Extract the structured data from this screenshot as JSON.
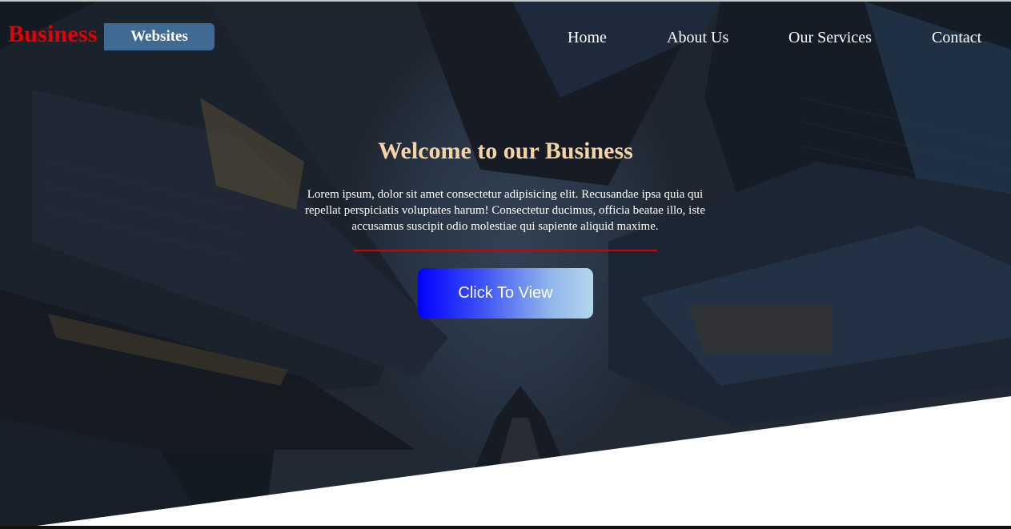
{
  "brand": {
    "name": "Business",
    "tag": "Websites"
  },
  "nav": {
    "items": [
      {
        "label": "Home"
      },
      {
        "label": "About Us"
      },
      {
        "label": "Our Services"
      },
      {
        "label": "Contact"
      }
    ]
  },
  "hero": {
    "title": "Welcome to our Business",
    "text": "Lorem ipsum, dolor sit amet consectetur adipisicing elit. Recusandae ipsa quia qui repellat perspiciatis voluptates harum! Consectetur ducimus, officia beatae illo, iste accusamus suscipit odio molestiae qui sapiente aliquid maxime.",
    "cta_label": "Click To View",
    "background": "city-skyscrapers-image"
  },
  "colors": {
    "brand_red": "#e60000",
    "tag_blue": "#3f6a93",
    "headline": "#f5d3a6",
    "divider": "#d50000",
    "cta_start": "#0000ff",
    "cta_end": "#b5d6ec"
  }
}
